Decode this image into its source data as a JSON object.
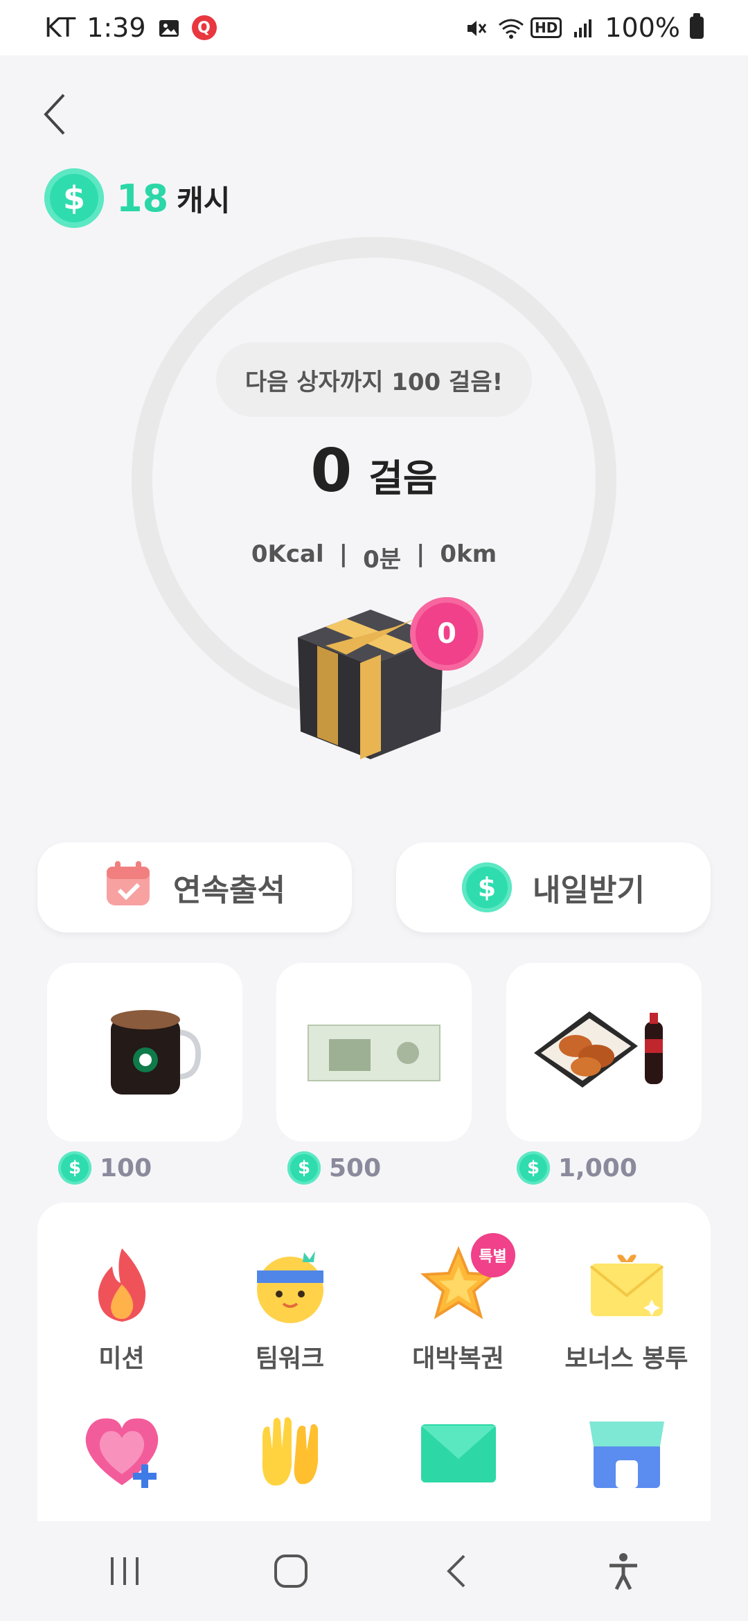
{
  "status_bar": {
    "carrier": "KT",
    "time": "1:39",
    "q_badge": "Q",
    "hd": "HD",
    "battery": "100%"
  },
  "header": {
    "cash_amount": "18",
    "cash_unit": "캐시",
    "coin_symbol": "$"
  },
  "tracker": {
    "next_box_message": "다음 상자까지 100 걸음!",
    "steps": "0",
    "steps_unit": "걸음",
    "kcal": "0Kcal",
    "minutes": "0분",
    "distance": "0km",
    "separator": "|",
    "box_count": "0"
  },
  "actions": {
    "attendance_label": "연속출석",
    "tomorrow_label": "내일받기"
  },
  "rewards": [
    {
      "price": "100",
      "icon": "coffee-mug-icon"
    },
    {
      "price": "500",
      "icon": "gift-voucher-icon"
    },
    {
      "price": "1,000",
      "icon": "chicken-and-cola-icon"
    }
  ],
  "menu": {
    "items": [
      {
        "label": "미션",
        "icon": "fire-icon"
      },
      {
        "label": "팀워크",
        "icon": "smiley-headband-icon"
      },
      {
        "label": "대박복권",
        "icon": "star-icon",
        "badge": "특별"
      },
      {
        "label": "보너스 봉투",
        "icon": "gold-envelope-icon"
      },
      {
        "label": "",
        "icon": "heart-plus-icon"
      },
      {
        "label": "",
        "icon": "clapping-hands-icon"
      },
      {
        "label": "",
        "icon": "green-envelope-icon"
      },
      {
        "label": "",
        "icon": "store-icon"
      }
    ]
  },
  "colors": {
    "accent_green": "#2bd7a6",
    "badge_pink": "#f0418a",
    "background": "#f5f5f7"
  }
}
